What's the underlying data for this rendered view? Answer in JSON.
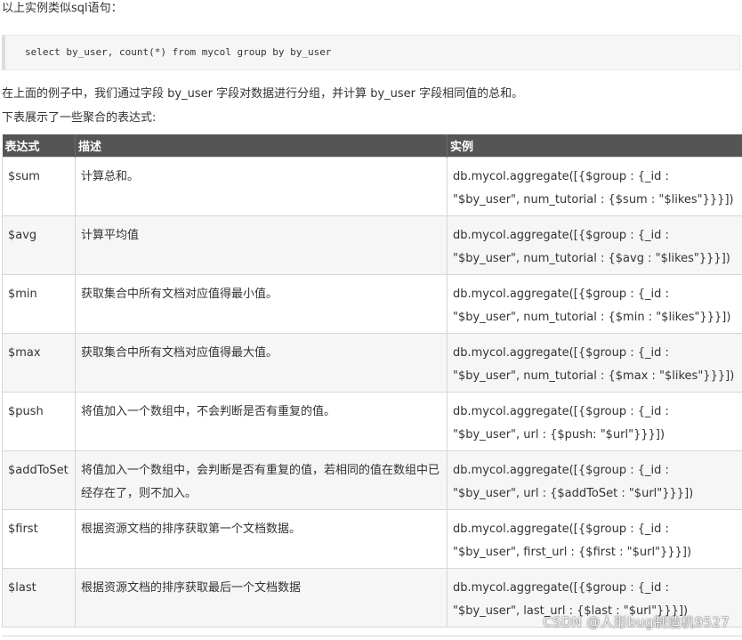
{
  "intro": "以上实例类似sql语句：",
  "code": {
    "parts": [
      {
        "text": "select",
        "kind": "kw"
      },
      {
        "text": " by_user, count(*) ",
        "kind": "plain"
      },
      {
        "text": "from",
        "kind": "kw"
      },
      {
        "text": " mycol ",
        "kind": "plain"
      },
      {
        "text": "group",
        "kind": "kw"
      },
      {
        "text": " ",
        "kind": "plain"
      },
      {
        "text": "by",
        "kind": "kw"
      },
      {
        "text": " by_user",
        "kind": "plain"
      }
    ]
  },
  "paragraph1": "在上面的例子中，我们通过字段 by_user 字段对数据进行分组，并计算 by_user 字段相同值的总和。",
  "paragraph2": "下表展示了一些聚合的表达式:",
  "table": {
    "headers": [
      "表达式",
      "描述",
      "实例"
    ],
    "rows": [
      {
        "expr": "$sum",
        "desc": "计算总和。",
        "example": "db.mycol.aggregate([{$group : {_id : \"$by_user\", num_tutorial : {$sum : \"$likes\"}}}])"
      },
      {
        "expr": "$avg",
        "desc": "计算平均值",
        "example": "db.mycol.aggregate([{$group : {_id : \"$by_user\", num_tutorial : {$avg : \"$likes\"}}}])"
      },
      {
        "expr": "$min",
        "desc": "获取集合中所有文档对应值得最小值。",
        "example": "db.mycol.aggregate([{$group : {_id : \"$by_user\", num_tutorial : {$min : \"$likes\"}}}])"
      },
      {
        "expr": "$max",
        "desc": "获取集合中所有文档对应值得最大值。",
        "example": "db.mycol.aggregate([{$group : {_id : \"$by_user\", num_tutorial : {$max : \"$likes\"}}}])"
      },
      {
        "expr": "$push",
        "desc": "将值加入一个数组中，不会判断是否有重复的值。",
        "example": "db.mycol.aggregate([{$group : {_id : \"$by_user\", url : {$push: \"$url\"}}}])"
      },
      {
        "expr": "$addToSet",
        "desc": "将值加入一个数组中，会判断是否有重复的值，若相同的值在数组中已经存在了，则不加入。",
        "example": "db.mycol.aggregate([{$group : {_id : \"$by_user\", url : {$addToSet : \"$url\"}}}])"
      },
      {
        "expr": "$first",
        "desc": "根据资源文档的排序获取第一个文档数据。",
        "example": "db.mycol.aggregate([{$group : {_id : \"$by_user\", first_url : {$first : \"$url\"}}}])"
      },
      {
        "expr": "$last",
        "desc": "根据资源文档的排序获取最后一个文档数据",
        "example": "db.mycol.aggregate([{$group : {_id : \"$by_user\", last_url : {$last : \"$url\"}}}])"
      }
    ]
  },
  "watermark": "CSDN @人形bug制造机9527"
}
